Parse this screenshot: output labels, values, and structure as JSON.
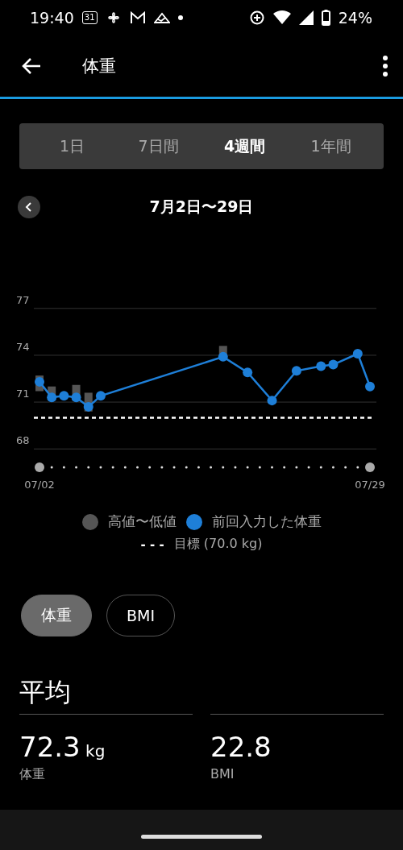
{
  "status_bar": {
    "time": "19:40",
    "calendar_day": "31",
    "battery": "24%"
  },
  "app_bar": {
    "title": "体重"
  },
  "period_tabs": [
    {
      "label": "1日",
      "selected": false
    },
    {
      "label": "7日間",
      "selected": false
    },
    {
      "label": "4週間",
      "selected": true
    },
    {
      "label": "1年間",
      "selected": false
    }
  ],
  "date_range": "7月2日〜29日",
  "chart_data": {
    "type": "line",
    "categories": [
      "07/02",
      null,
      null,
      null,
      null,
      null,
      null,
      null,
      null,
      null,
      null,
      null,
      null,
      null,
      null,
      null,
      null,
      null,
      null,
      null,
      null,
      null,
      null,
      null,
      null,
      null,
      null,
      "07/29"
    ],
    "yticks": [
      68,
      71,
      74,
      77
    ],
    "ylim": [
      68,
      77
    ],
    "series": [
      {
        "name": "前回入力した体重",
        "color": "#1e7fd8",
        "marker": "circle",
        "values": [
          72.3,
          71.3,
          71.4,
          71.3,
          70.7,
          71.4,
          null,
          null,
          null,
          null,
          null,
          null,
          null,
          null,
          null,
          73.9,
          null,
          72.9,
          null,
          71.1,
          null,
          73.0,
          null,
          73.3,
          73.4,
          null,
          74.1,
          72.0
        ],
        "errors": [
          [
            71.7,
            72.7
          ],
          [
            71.1,
            72.0
          ],
          null,
          [
            71.1,
            72.1
          ],
          [
            70.4,
            71.6
          ],
          null,
          null,
          null,
          null,
          null,
          null,
          null,
          null,
          null,
          null,
          [
            73.7,
            74.6
          ],
          null,
          null,
          null,
          null,
          null,
          null,
          null,
          null,
          null,
          null,
          null,
          null
        ]
      }
    ],
    "ref_lines": [
      {
        "axis": "y",
        "value": 70.0
      }
    ]
  },
  "legend": {
    "items": [
      {
        "label": "高値〜低値",
        "color": "#555555"
      }
    ],
    "goal_label": "目標 (70.0 kg)",
    "goal_mark": "- - -"
  },
  "metric_tabs": [
    {
      "label": "体重",
      "selected": true
    },
    {
      "label": "BMI",
      "selected": false
    }
  ],
  "average": {
    "heading": "平均",
    "stats": [
      {
        "value": "72.3",
        "unit": "kg",
        "label": "体重"
      },
      {
        "value": "22.8",
        "label": "BMI"
      }
    ]
  }
}
